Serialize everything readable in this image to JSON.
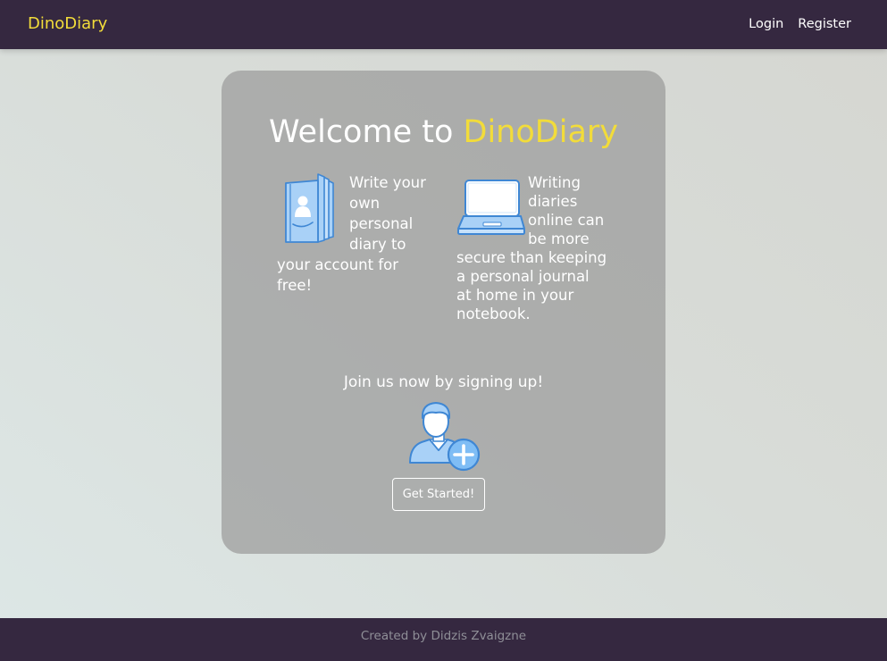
{
  "nav": {
    "brand": "DinoDiary",
    "links": [
      "Login",
      "Register"
    ]
  },
  "hero": {
    "title_prefix": "Welcome to ",
    "title_accent": "DinoDiary"
  },
  "features": [
    {
      "icon": "notebook-icon",
      "text": "Write your own personal diary to your account for free!"
    },
    {
      "icon": "laptop-icon",
      "text": "Writing diaries online can be more secure than keeping a personal journal at home in your notebook."
    }
  ],
  "cta": {
    "prompt": "Join us now by signing up!",
    "icon": "add-user-icon",
    "button_label": "Get Started!"
  },
  "footer": {
    "text": "Created by Didzis Zvaigzne"
  },
  "colors": {
    "navbar": "#352840",
    "accent": "#f2dc3a",
    "icon_fill": "#a9d1f7",
    "icon_stroke": "#3f87d4"
  }
}
